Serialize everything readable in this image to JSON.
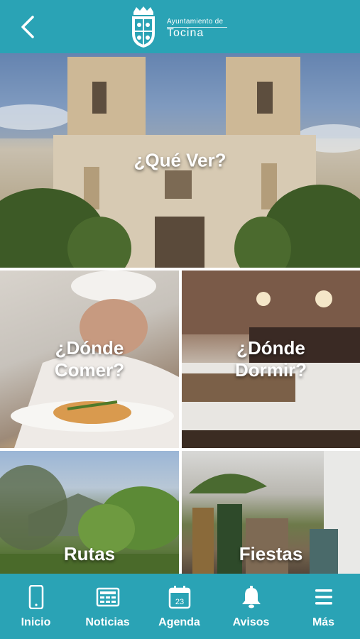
{
  "header": {
    "logo_small": "Ayuntamiento de",
    "logo_big": "Tocina",
    "back_icon": "chevron-left-icon",
    "color": "#2aa3b5"
  },
  "tiles": [
    {
      "label": "¿Qué Ver?"
    },
    {
      "label_line1": "¿Dónde",
      "label_line2": "Comer?"
    },
    {
      "label_line1": "¿Dónde",
      "label_line2": "Dormir?"
    },
    {
      "label": "Rutas"
    },
    {
      "label": "Fiestas"
    }
  ],
  "tabbar": {
    "items": [
      {
        "label": "Inicio",
        "icon": "phone-icon"
      },
      {
        "label": "Noticias",
        "icon": "newspaper-icon"
      },
      {
        "label": "Agenda",
        "icon": "calendar-icon",
        "day": "23"
      },
      {
        "label": "Avisos",
        "icon": "bell-icon"
      },
      {
        "label": "Más",
        "icon": "menu-icon"
      }
    ]
  }
}
